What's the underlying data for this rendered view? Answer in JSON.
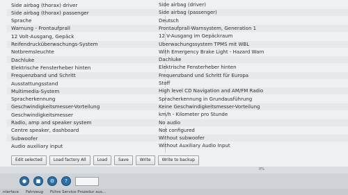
{
  "rows": [
    {
      "name": "Side airbag (thorax) driver",
      "value": "Side airbag (driver)"
    },
    {
      "name": "Side airbag (thorax) passenger",
      "value": "Side airbag (passenger)"
    },
    {
      "name": "Sprache",
      "value": "Deutsch"
    },
    {
      "name": "Warnung - Frontaufprall",
      "value": "Frontaufprall-Warnsystem, Generation 1"
    },
    {
      "name": "12 Volt-Ausgang, Gepäck",
      "value": "12 V-Ausgang im Gepäckraum"
    },
    {
      "name": "Reifendrucküberwachungs-System",
      "value": "Überwachungssystem TPMS mit WBL"
    },
    {
      "name": "Notbremsleuchte",
      "value": "With Emergency Brake Light - Hazard Warn"
    },
    {
      "name": "Dachluke",
      "value": "Dachluke"
    },
    {
      "name": "Elektrische Fensterheber hinten",
      "value": "Elektrische Fensterheber hinten"
    },
    {
      "name": "Frequenzband und Schritt",
      "value": "Frequenzband und Schritt für Europa"
    },
    {
      "name": "Ausstattungsstand",
      "value": "Stoff"
    },
    {
      "name": "Multimedia-System",
      "value": "High level CD Navigation and AM/FM Radio"
    },
    {
      "name": "Spracherkennung",
      "value": "Spracherkennung in Grundausführung"
    },
    {
      "name": "Geschwindigkeitsmesser-Vorteilung",
      "value": "Keine Geschwindigkeitsmesser-Vorteilung"
    },
    {
      "name": "Geschwindigkeitsmesser",
      "value": "km/h - Kilometer pro Stunde"
    },
    {
      "name": "Radio, amp and speaker system",
      "value": "No audio"
    },
    {
      "name": "Centre speaker, dashboard",
      "value": "Not configured"
    },
    {
      "name": "Subwoofer",
      "value": "Without subwoofer"
    },
    {
      "name": "Audio auxiliary input",
      "value": "Without Auxiliary Audio Input"
    }
  ],
  "buttons": {
    "edit_selected": "Edit selected",
    "load_factory": "Load factory All",
    "load": "Load",
    "save": "Save",
    "write": "Write",
    "write_backup": "Write to backup"
  },
  "progress_text": "0%",
  "taskbar": {
    "input_value": ""
  },
  "statusbar": {
    "item1": "nterface",
    "item2": "Fahrzeug",
    "item3": "Führe Service Prozedur aus..."
  }
}
